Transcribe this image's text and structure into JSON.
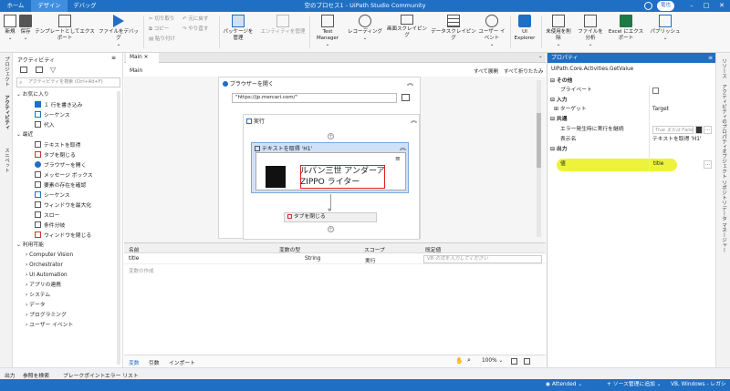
{
  "titlebar": {
    "tabs": [
      "ホーム",
      "デザイン",
      "デバッグ"
    ],
    "title": "空のプロセス1 - UiPath Studio Community",
    "user": "竜也"
  },
  "ribbon": {
    "new": "新規",
    "save": "保存",
    "export_template": "テンプレートとしてエクスポート",
    "debug_file": "ファイルをデバッグ",
    "cut": "切り取り",
    "copy": "コピー",
    "paste": "貼り付け",
    "undo": "元に戻す",
    "redo": "やり直す",
    "package_manage": "パッケージを管理",
    "entity_manage": "エンティティを管理",
    "test_manager": "Test Manager",
    "recording": "レコーディング",
    "screen_scraping": "画面スクレイピング",
    "data_scraping": "データスクレイピング",
    "user_events": "ユーザー イベント",
    "ui_explorer": "UI Explorer",
    "remove_unused": "未使用を削除",
    "analyze_file": "ファイルを分析",
    "export_excel": "Excel にエクスポート",
    "publish": "パブリッシュ"
  },
  "left_strip": [
    "プロジェクト",
    "アクティビティ",
    "スニペット"
  ],
  "activities": {
    "title": "アクティビティ",
    "search_placeholder": "アクティビティを検索 (Ctrl+Alt+F)",
    "favorites": "お気に入り",
    "fav_items": [
      "１ 行を書き込み",
      "シーケンス",
      "代入"
    ],
    "recent": "最近",
    "recent_items": [
      "テキストを取得",
      "タブを閉じる",
      "ブラウザーを開く",
      "メッセージ ボックス",
      "要素の存在を確認",
      "シーケンス",
      "ウィンドウを最大化",
      "スロー",
      "条件分岐",
      "ウィンドウを閉じる"
    ],
    "available": "利用可能",
    "categories": [
      "Computer Vision",
      "Orchestrator",
      "UI Automation",
      "アプリの連携",
      "システム",
      "データ",
      "プログラミング",
      "ユーザー イベント"
    ]
  },
  "designer": {
    "tab": "Main",
    "breadcrumb": "Main",
    "expand_all": "すべて展開",
    "collapse_all": "すべて折りたたみ",
    "browser_activity": "ブラウザーを開く",
    "url": "\"https://jp.mercari.com/\"",
    "do_label": "実行",
    "get_text": "テキストを取得 'H1'",
    "screenshot_text_line1": "ルパン三世 アンダーア",
    "screenshot_text_line2": "ZIPPO ライター",
    "close_tab": "タブを閉じる"
  },
  "variables": {
    "headers": [
      "名前",
      "変数の型",
      "スコープ",
      "既定値"
    ],
    "rows": [
      {
        "name": "title",
        "type": "String",
        "scope": "実行",
        "default": "VB の式を入力してください"
      }
    ],
    "create_hint": "変数の作成",
    "tabs": [
      "変数",
      "引数",
      "インポート"
    ],
    "zoom": "100%"
  },
  "properties": {
    "title": "プロパティ",
    "activity_type": "UiPath.Core.Activities.GetValue",
    "misc": "その他",
    "private": "プライベート",
    "input": "入力",
    "target_label": "ターゲット",
    "target_value": "Target",
    "common": "共通",
    "continue_on_error": "エラー発生時に実行を継続",
    "continue_placeholder": "True または False を入力",
    "display_name": "表示名",
    "display_value": "テキストを取得 'H1'",
    "output": "出力",
    "value_label": "値",
    "value_value": "title"
  },
  "right_strip": [
    "リソース",
    "アクティビティのプロパティ",
    "オブジェクト リポジトリ",
    "データ マネージャー"
  ],
  "output_tabs": [
    "出力",
    "参照を検索",
    "ブレークポイント",
    "エラー リスト"
  ],
  "status": {
    "attended": "Attended",
    "source_control": "+ ソース管理に追加",
    "project_type": "VB, Windows - レガシ"
  },
  "colors": {
    "accent": "#1f6fc4",
    "highlight": "#ecf33a"
  }
}
